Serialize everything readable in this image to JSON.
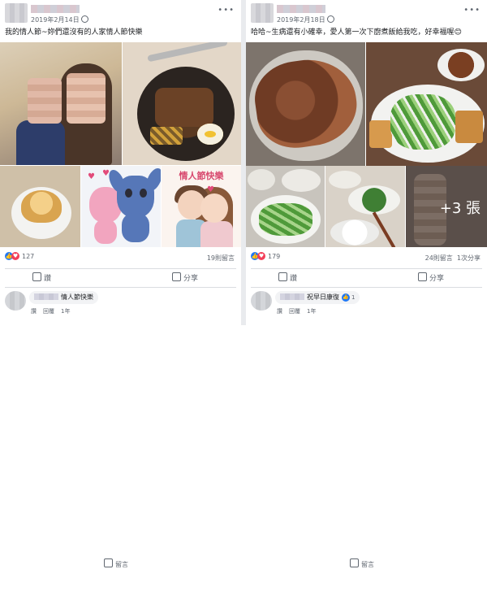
{
  "left_post": {
    "date": "2019年2月14日",
    "caption": "我的情人節~妳們還沒有的人家情人節快樂",
    "love_banner": "情人節快樂",
    "reactions_count": "127",
    "comments_count": "19則留言",
    "actions": {
      "like": "讚",
      "comment": "留言",
      "share": "分享"
    },
    "comment": {
      "text": "情人節快樂",
      "like": "讚",
      "reply": "回覆",
      "time": "1年"
    }
  },
  "right_post": {
    "date": "2019年2月18日",
    "caption": "哈哈~生病還有小確幸，愛人第一次下廚煮飯給我吃，好幸福喔😊",
    "more_photos": "+3 張",
    "reactions_count": "179",
    "comments_count": "24則留言",
    "shares_count": "1次分享",
    "actions": {
      "like": "讚",
      "comment": "留言",
      "share": "分享"
    },
    "comment": {
      "text": "祝早日康復",
      "like": "讚",
      "reply": "回覆",
      "time": "1年",
      "reaction_count": "1"
    }
  },
  "colors": {
    "facebook_blue": "#2078f4",
    "love_red": "#f33e58",
    "meta_gray": "#606770"
  },
  "icons": [
    "globe-icon",
    "more-icon",
    "like-icon",
    "comment-icon",
    "share-icon",
    "love-icon"
  ]
}
